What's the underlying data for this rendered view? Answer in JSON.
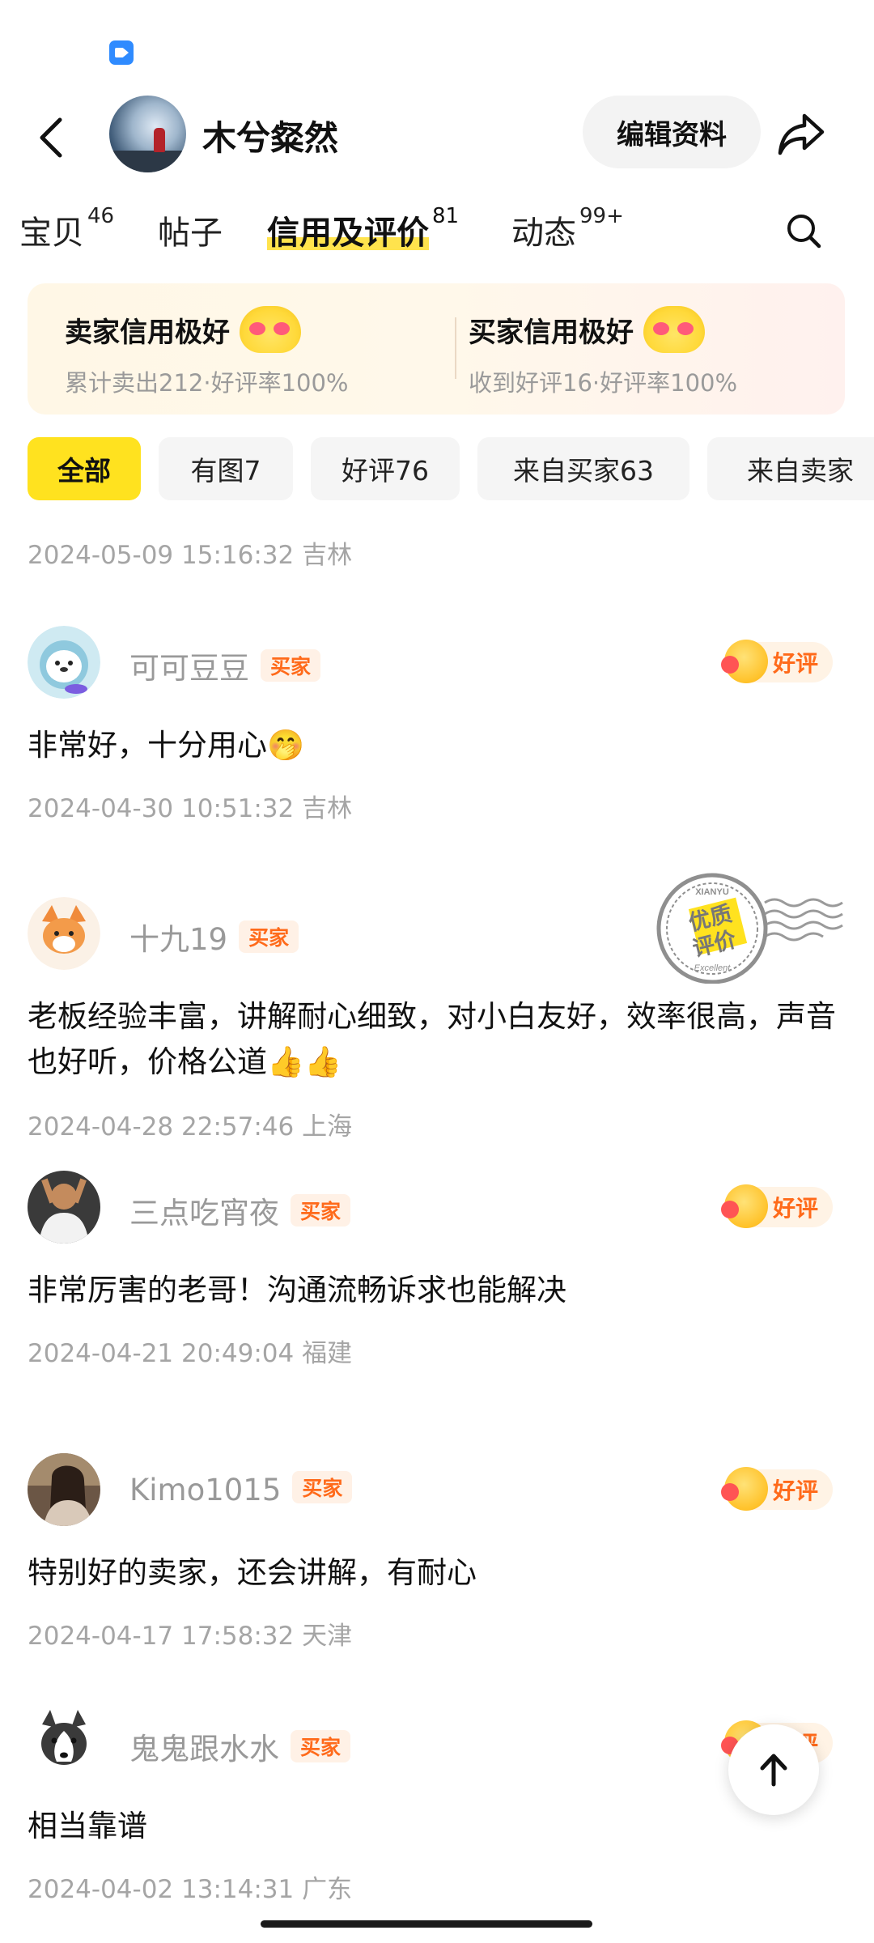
{
  "header": {
    "nickname": "木兮粲然",
    "edit_label": "编辑资料"
  },
  "tabs": [
    {
      "label": "宝贝",
      "count": "46"
    },
    {
      "label": "帖子",
      "count": ""
    },
    {
      "label": "信用及评价",
      "count": "81"
    },
    {
      "label": "动态",
      "count": "99+"
    }
  ],
  "credit": {
    "seller": {
      "title": "卖家信用极好",
      "sub": "累计卖出212·好评率100%"
    },
    "buyer": {
      "title": "买家信用极好",
      "sub": "收到好评16·好评率100%"
    }
  },
  "filters": [
    "全部",
    "有图7",
    "好评76",
    "来自买家63",
    "来自卖家"
  ],
  "first_meta": "2024-05-09 15:16:32  吉林",
  "stamp": {
    "top": "XIANYU",
    "main1": "优质",
    "main2": "评价",
    "bottom": "Excellent"
  },
  "reviews": [
    {
      "name": "可可豆豆",
      "tag": "买家",
      "badge": "好评",
      "text": "非常好，十分用心🤭",
      "meta": "2024-04-30 10:51:32  吉林"
    },
    {
      "name": "十九19",
      "tag": "买家",
      "badge": "",
      "text": "老板经验丰富，讲解耐心细致，对小白友好，效率很高，声音也好听，价格公道👍👍",
      "meta": "2024-04-28 22:57:46  上海"
    },
    {
      "name": "三点吃宵夜",
      "tag": "买家",
      "badge": "好评",
      "text": "非常厉害的老哥！沟通流畅诉求也能解决",
      "meta": "2024-04-21 20:49:04  福建"
    },
    {
      "name": "Kimo1015",
      "tag": "买家",
      "badge": "好评",
      "text": "特别好的卖家，还会讲解，有耐心",
      "meta": "2024-04-17 17:58:32  天津"
    },
    {
      "name": "鬼鬼跟水水",
      "tag": "买家",
      "badge": "好评",
      "text": "相当靠谱",
      "meta": "2024-04-02 13:14:31  广东"
    }
  ],
  "icons": {
    "back": "chevron-left-icon",
    "share": "share-arrow-icon",
    "search": "search-icon",
    "scroll_top": "arrow-up-icon"
  },
  "colors": {
    "accent_yellow": "#ffe21f",
    "tag_orange": "#ff6a1a"
  }
}
